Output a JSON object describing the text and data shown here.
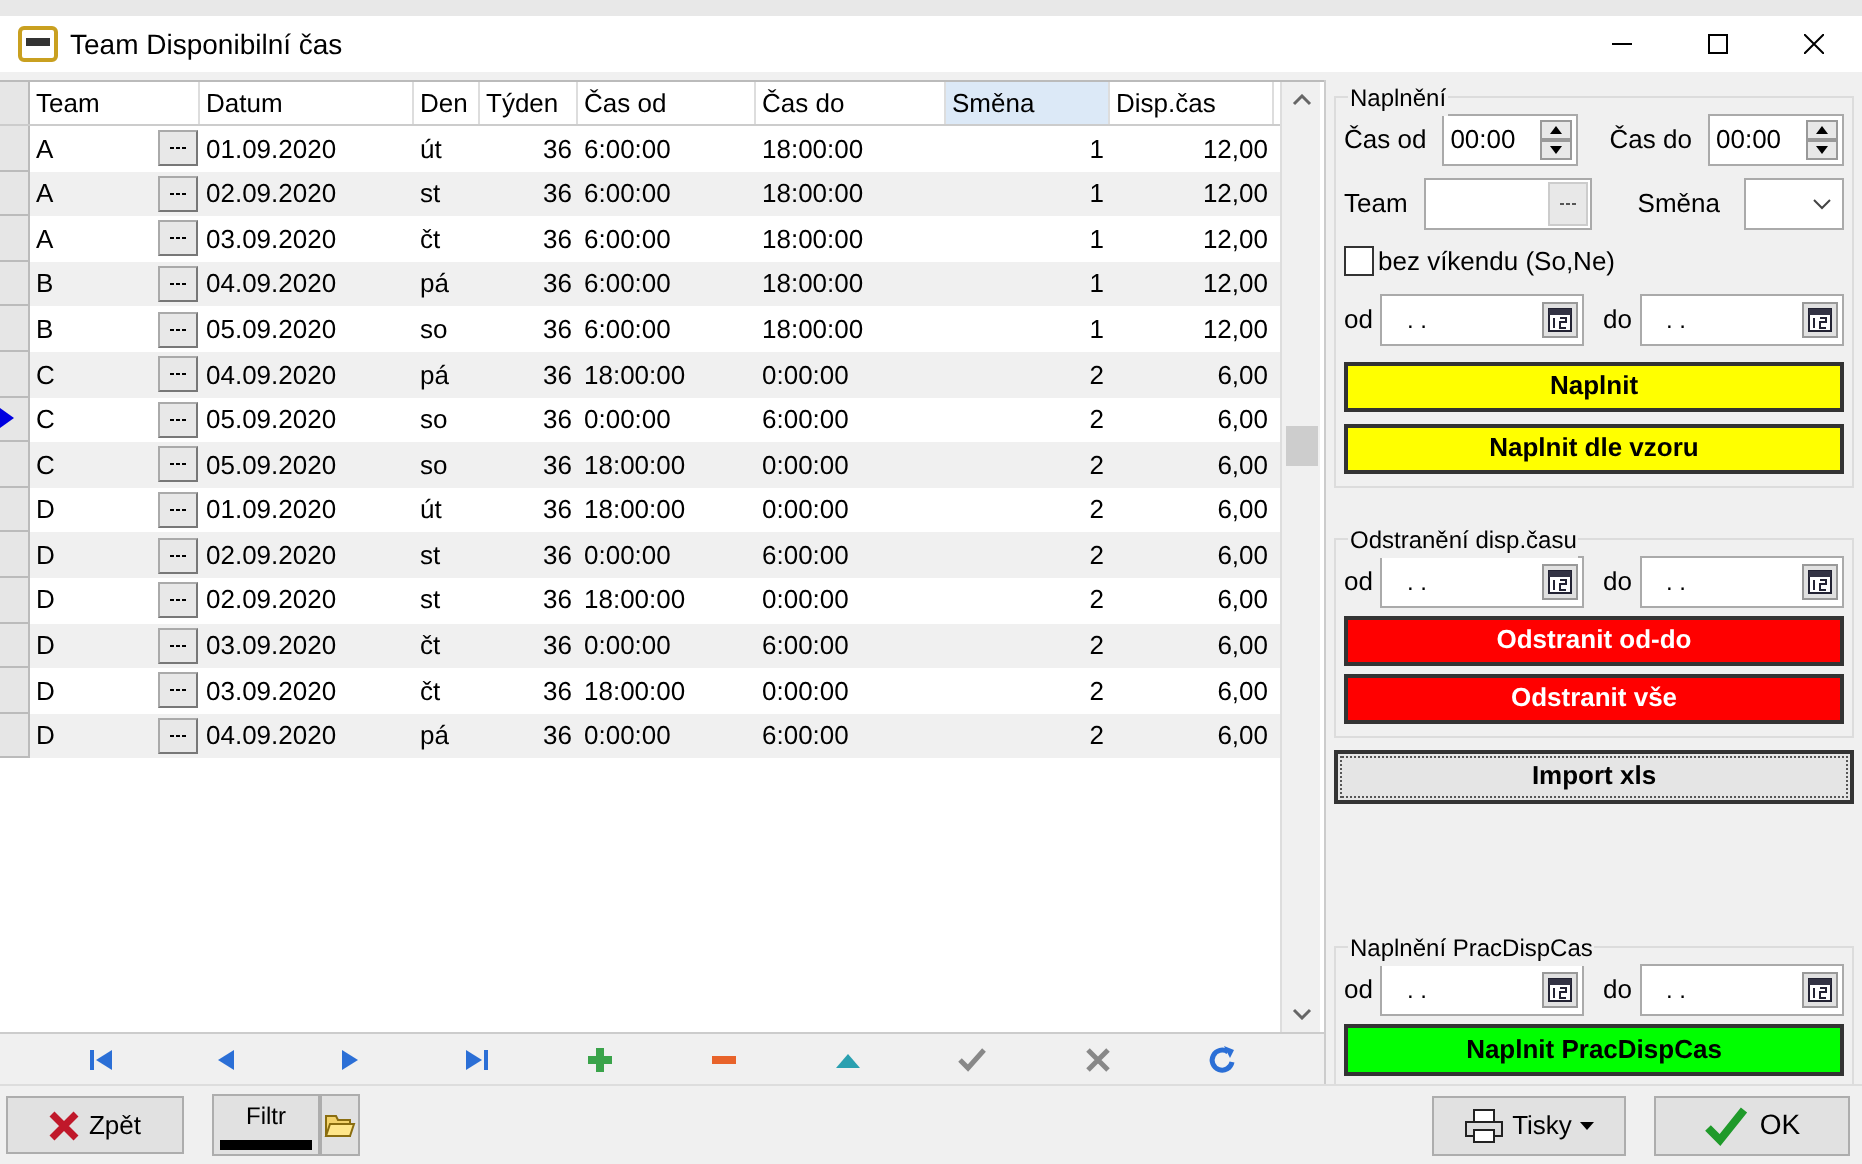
{
  "window": {
    "title": "Team Disponibilní čas"
  },
  "grid": {
    "columns": [
      {
        "label": "Team",
        "sorted": false
      },
      {
        "label": "Datum",
        "sorted": false
      },
      {
        "label": "Den",
        "sorted": false
      },
      {
        "label": "Týden",
        "sorted": false
      },
      {
        "label": "Čas od",
        "sorted": false
      },
      {
        "label": "Čas do",
        "sorted": false
      },
      {
        "label": "Směna",
        "sorted": true
      },
      {
        "label": "Disp.čas",
        "sorted": false
      }
    ],
    "rows": [
      {
        "current": false,
        "cells": [
          "A",
          "01.09.2020",
          "út",
          "36",
          "6:00:00",
          "18:00:00",
          "1",
          "12,00"
        ]
      },
      {
        "current": false,
        "cells": [
          "A",
          "02.09.2020",
          "st",
          "36",
          "6:00:00",
          "18:00:00",
          "1",
          "12,00"
        ]
      },
      {
        "current": false,
        "cells": [
          "A",
          "03.09.2020",
          "čt",
          "36",
          "6:00:00",
          "18:00:00",
          "1",
          "12,00"
        ]
      },
      {
        "current": false,
        "cells": [
          "B",
          "04.09.2020",
          "pá",
          "36",
          "6:00:00",
          "18:00:00",
          "1",
          "12,00"
        ]
      },
      {
        "current": false,
        "cells": [
          "B",
          "05.09.2020",
          "so",
          "36",
          "6:00:00",
          "18:00:00",
          "1",
          "12,00"
        ]
      },
      {
        "current": false,
        "cells": [
          "C",
          "04.09.2020",
          "pá",
          "36",
          "18:00:00",
          "0:00:00",
          "2",
          "6,00"
        ]
      },
      {
        "current": true,
        "cells": [
          "C",
          "05.09.2020",
          "so",
          "36",
          "0:00:00",
          "6:00:00",
          "2",
          "6,00"
        ]
      },
      {
        "current": false,
        "cells": [
          "C",
          "05.09.2020",
          "so",
          "36",
          "18:00:00",
          "0:00:00",
          "2",
          "6,00"
        ]
      },
      {
        "current": false,
        "cells": [
          "D",
          "01.09.2020",
          "út",
          "36",
          "18:00:00",
          "0:00:00",
          "2",
          "6,00"
        ]
      },
      {
        "current": false,
        "cells": [
          "D",
          "02.09.2020",
          "st",
          "36",
          "0:00:00",
          "6:00:00",
          "2",
          "6,00"
        ]
      },
      {
        "current": false,
        "cells": [
          "D",
          "02.09.2020",
          "st",
          "36",
          "18:00:00",
          "0:00:00",
          "2",
          "6,00"
        ]
      },
      {
        "current": false,
        "cells": [
          "D",
          "03.09.2020",
          "čt",
          "36",
          "0:00:00",
          "6:00:00",
          "2",
          "6,00"
        ]
      },
      {
        "current": false,
        "cells": [
          "D",
          "03.09.2020",
          "čt",
          "36",
          "18:00:00",
          "0:00:00",
          "2",
          "6,00"
        ]
      },
      {
        "current": false,
        "cells": [
          "D",
          "04.09.2020",
          "pá",
          "36",
          "0:00:00",
          "6:00:00",
          "2",
          "6,00"
        ]
      }
    ]
  },
  "fill": {
    "title": "Naplnění",
    "time_from": {
      "label": "Čas od",
      "value": "00:00"
    },
    "time_to": {
      "label": "Čas do",
      "value": "00:00"
    },
    "team": {
      "label": "Team"
    },
    "shift": {
      "label": "Směna"
    },
    "weekend": {
      "label": "bez víkendu (So,Ne)",
      "checked": false
    },
    "from": {
      "label": "od",
      "value": ". ."
    },
    "to": {
      "label": "do",
      "value": ". ."
    },
    "buttons": [
      "Naplnit",
      "Naplnit dle vzoru"
    ]
  },
  "remove": {
    "title": "Odstranění disp.času",
    "from": {
      "label": "od",
      "value": ". ."
    },
    "to": {
      "label": "do",
      "value": ". ."
    },
    "buttons": [
      "Odstranit od-do",
      "Odstranit vše"
    ]
  },
  "import_button": "Import xls",
  "work_fill": {
    "title": "Naplnění PracDispCas",
    "from": {
      "label": "od",
      "value": ". ."
    },
    "to": {
      "label": "do",
      "value": ". ."
    },
    "button": "Naplnit PracDispCas"
  },
  "footer": {
    "back": "Zpět",
    "filter": "Filtr",
    "print": "Tisky",
    "ok": "OK"
  }
}
